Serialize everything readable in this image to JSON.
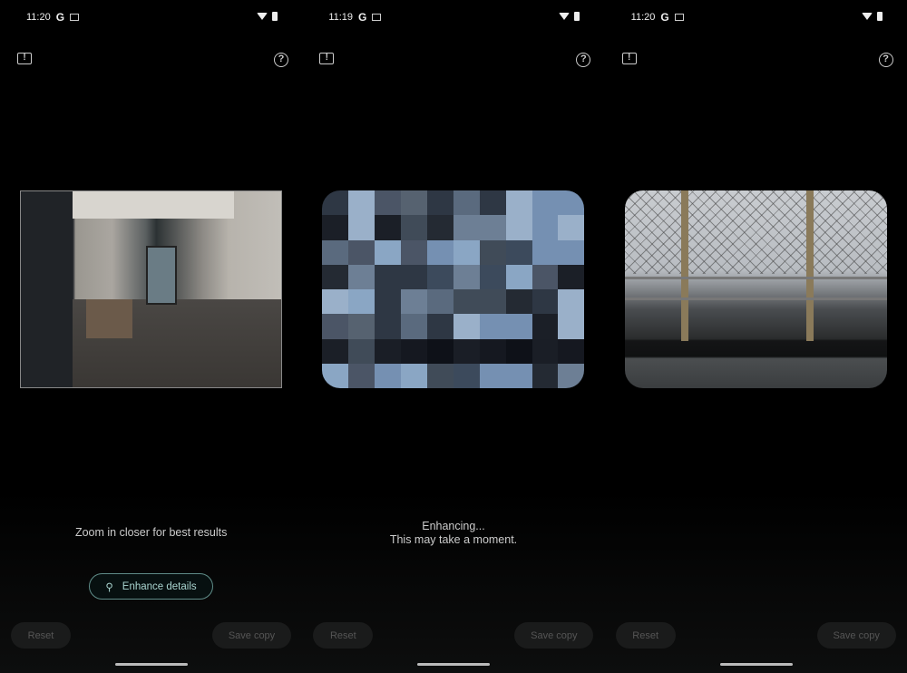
{
  "screens": [
    {
      "time": "11:20",
      "message": [
        "Zoom in closer for best results"
      ],
      "enhance_label": "Enhance details",
      "image": "room-photo"
    },
    {
      "time": "11:19",
      "message": [
        "Enhancing...",
        "This may take a moment."
      ],
      "image": "pixelated-preview"
    },
    {
      "time": "11:20",
      "message": [],
      "image": "enhanced-railing-photo"
    }
  ],
  "buttons": {
    "reset": "Reset",
    "save_copy": "Save copy"
  },
  "status_icons": {
    "google": "G",
    "notification": "calendar-icon",
    "wifi": "wifi-icon",
    "battery": "battery-icon"
  },
  "icons": {
    "feedback": "!",
    "help": "?"
  },
  "colors": {
    "accent": "#a9d4cf",
    "outline": "#5f8c88",
    "background": "#000000"
  }
}
